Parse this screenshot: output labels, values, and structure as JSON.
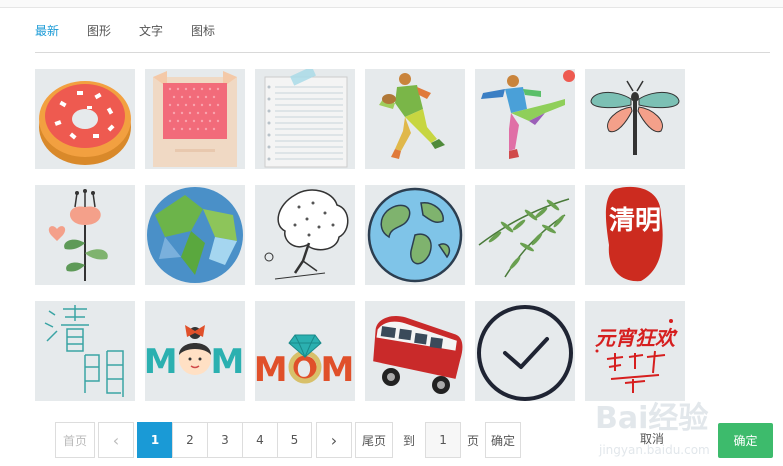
{
  "tabs": [
    {
      "label": "最新",
      "active": true
    },
    {
      "label": "图形",
      "active": false
    },
    {
      "label": "文字",
      "active": false
    },
    {
      "label": "图标",
      "active": false
    }
  ],
  "tiles": [
    {
      "name": "donut",
      "icon": "donut-icon"
    },
    {
      "name": "polaroid",
      "icon": "polaroid-icon"
    },
    {
      "name": "notepaper",
      "icon": "notepaper-icon"
    },
    {
      "name": "runner",
      "icon": "rugby-player-icon"
    },
    {
      "name": "kicker",
      "icon": "soccer-player-icon"
    },
    {
      "name": "dragonfly",
      "icon": "dragonfly-icon"
    },
    {
      "name": "flower",
      "icon": "flower-icon"
    },
    {
      "name": "globe-lowpoly",
      "icon": "globe-icon"
    },
    {
      "name": "tree-sketch",
      "icon": "tree-icon"
    },
    {
      "name": "globe-cartoon",
      "icon": "earth-icon"
    },
    {
      "name": "willow",
      "icon": "willow-branch-icon"
    },
    {
      "name": "qingming-seal",
      "icon": "qingming-seal-icon",
      "text": "清明"
    },
    {
      "name": "qingming-line",
      "icon": "qingming-calligraphy-icon",
      "text": "清明"
    },
    {
      "name": "mom-girl",
      "icon": "mom-girl-icon",
      "text": "MOM"
    },
    {
      "name": "mom-ring",
      "icon": "mom-ring-icon",
      "text": "MOM"
    },
    {
      "name": "vw-bus",
      "icon": "van-icon"
    },
    {
      "name": "check-circle",
      "icon": "check-circle-icon"
    },
    {
      "name": "yuanxiao",
      "icon": "yuanxiao-calligraphy-icon",
      "text": "元宵狂欢"
    }
  ],
  "pager": {
    "first": "首页",
    "prev": "‹",
    "pages": [
      "1",
      "2",
      "3",
      "4",
      "5"
    ],
    "current": "1",
    "next": "›",
    "last": "尾页",
    "goto_label": "到",
    "page_input": "1",
    "page_label": "页",
    "go": "确定"
  },
  "footer": {
    "cancel": "取消",
    "ok": "确定"
  },
  "watermark": {
    "text": "Bai经验",
    "url": "jingyan.baidu.com"
  },
  "colors": {
    "accent": "#1a9ad6",
    "ok": "#3dbb6c",
    "tile_bg": "#e6eaec"
  }
}
